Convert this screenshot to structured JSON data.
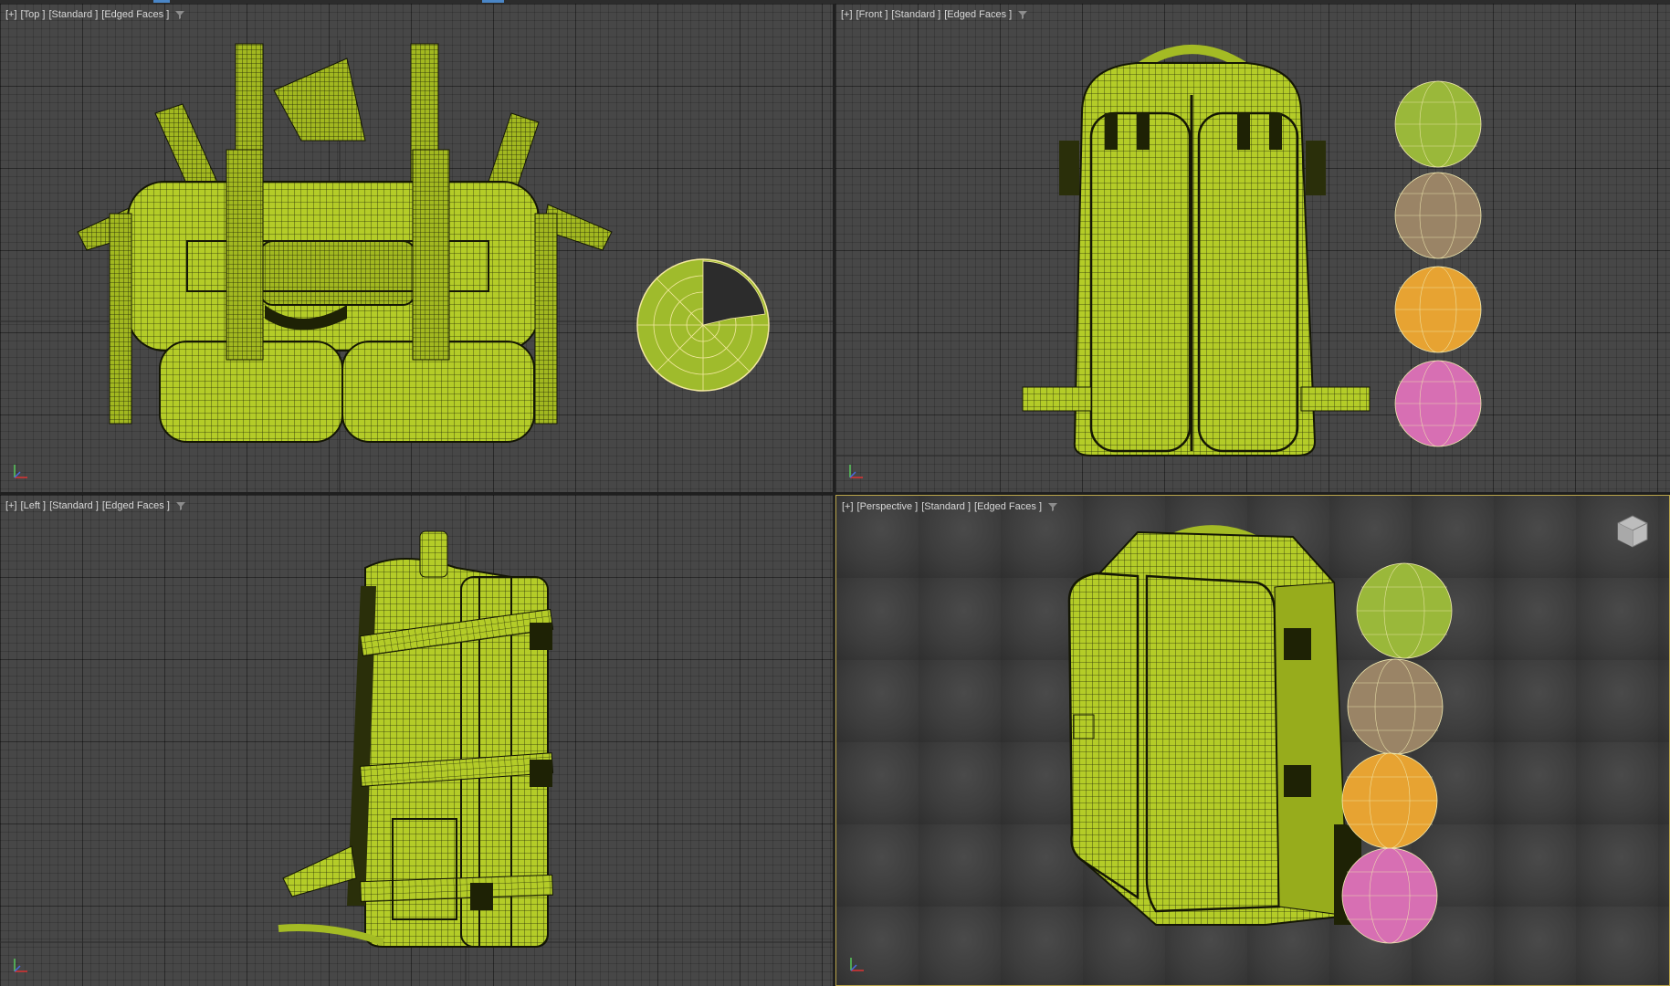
{
  "viewports": {
    "top": {
      "plus": "[+]",
      "view": "[Top ]",
      "shading": "[Standard ]",
      "edges": "[Edged Faces ]"
    },
    "front": {
      "plus": "[+]",
      "view": "[Front ]",
      "shading": "[Standard ]",
      "edges": "[Edged Faces ]"
    },
    "left": {
      "plus": "[+]",
      "view": "[Left ]",
      "shading": "[Standard ]",
      "edges": "[Edged Faces ]"
    },
    "persp": {
      "plus": "[+]",
      "view": "[Perspective ]",
      "shading": "[Standard ]",
      "edges": "[Edged Faces ]"
    }
  },
  "icons": {
    "filter": "filter-icon",
    "axis": "axis-tripod-icon",
    "viewcube": "viewcube-icon"
  },
  "colors": {
    "viewport_bg": "#474747",
    "mesh": "#b7cf2a",
    "mesh_dark": "#6f7d14",
    "wire": "#1e2205",
    "active_border": "#b9a44a",
    "sphere_green": "#9ab83a",
    "sphere_brown": "#9a8466",
    "sphere_orange": "#e7a332",
    "sphere_pink": "#d76fb3"
  }
}
